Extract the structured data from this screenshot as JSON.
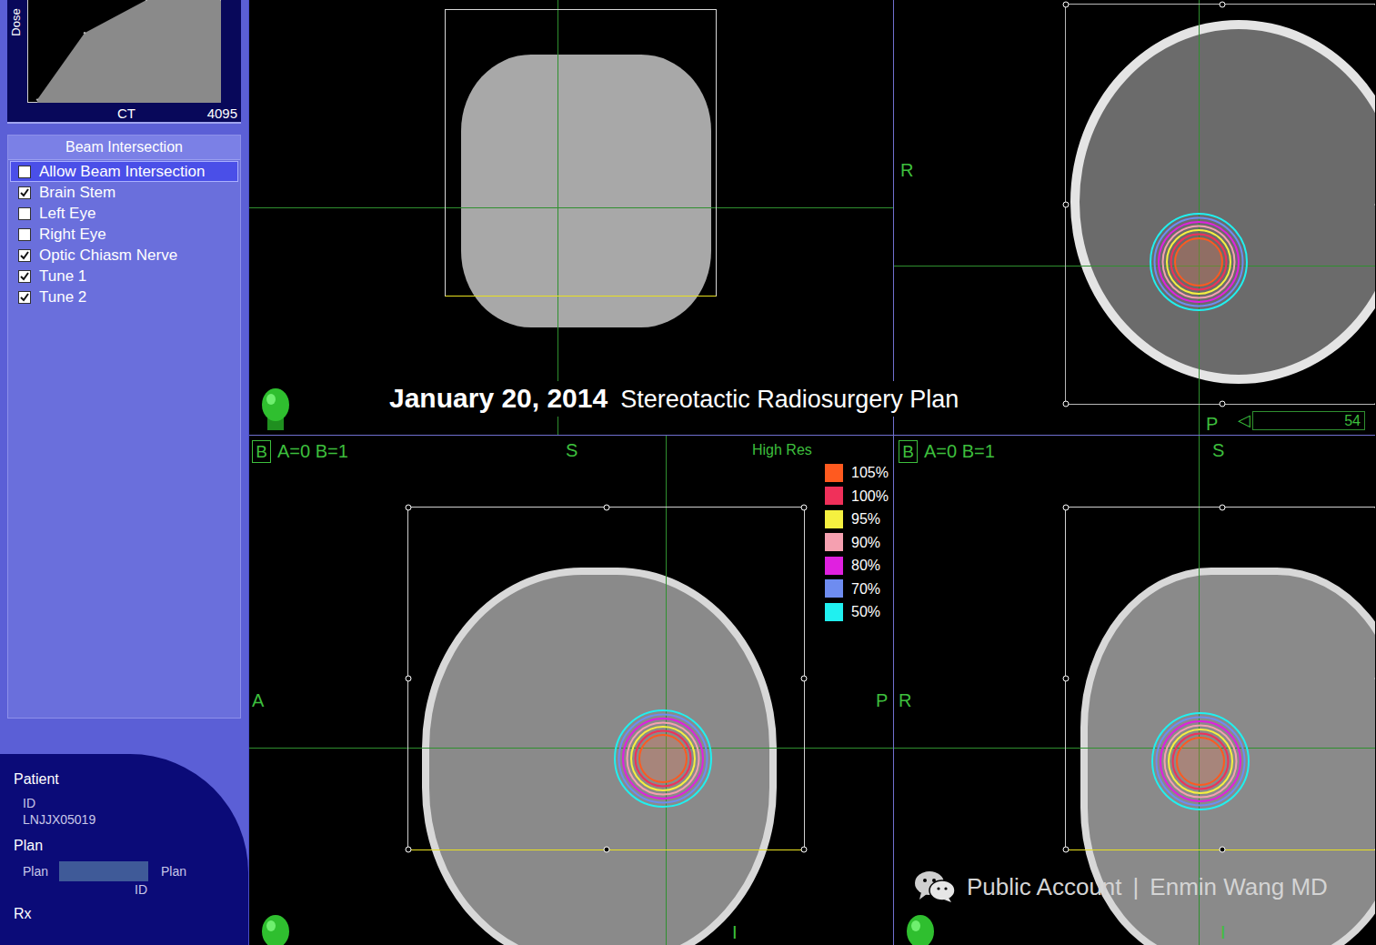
{
  "dose_chart": {
    "y_label": "Dose",
    "x_label": "CT",
    "x_max": "4095",
    "points": [
      [
        193,
        0.03
      ],
      [
        1198,
        0.68
      ],
      [
        2511,
        1.0
      ],
      [
        4095,
        1.0
      ]
    ]
  },
  "beam_intersection": {
    "title": "Beam Intersection",
    "items": [
      {
        "label": "Allow Beam Intersection",
        "checked": false,
        "selected": true
      },
      {
        "label": "Brain Stem",
        "checked": true,
        "selected": false
      },
      {
        "label": "Left Eye",
        "checked": false,
        "selected": false
      },
      {
        "label": "Right Eye",
        "checked": false,
        "selected": false
      },
      {
        "label": "Optic Chiasm Nerve",
        "checked": true,
        "selected": false
      },
      {
        "label": "Tune 1",
        "checked": true,
        "selected": false
      },
      {
        "label": "Tune 2",
        "checked": true,
        "selected": false
      }
    ]
  },
  "patient": {
    "title": "Patient",
    "id_label": "ID",
    "id": "LNJJX05019"
  },
  "plan": {
    "title": "Plan",
    "label": "Plan",
    "unit": "Plan",
    "id_label": "ID"
  },
  "rx": {
    "title": "Rx"
  },
  "caption": {
    "date": "January 20, 2014",
    "title": "Stereotactic Radiosurgery Plan"
  },
  "views": {
    "axial": {
      "labels": {
        "left": "R",
        "bottom": "P"
      },
      "slice": {
        "arrow": "◁",
        "value": "54"
      }
    },
    "sagittal": {
      "badge": "B",
      "angles": "A=0 B=1",
      "labels": {
        "top": "S",
        "left": "A",
        "right": "P",
        "bottom": "I"
      }
    },
    "coronal": {
      "badge": "B",
      "angles": "A=0 B=1",
      "labels": {
        "top": "S",
        "left": "R",
        "bottom": "I"
      }
    }
  },
  "legend": {
    "title": "High Res",
    "items": [
      {
        "label": "105%",
        "color": "#ff5a1f"
      },
      {
        "label": "100%",
        "color": "#f0305a"
      },
      {
        "label": "95%",
        "color": "#f5f040"
      },
      {
        "label": "90%",
        "color": "#f5a0b0"
      },
      {
        "label": "80%",
        "color": "#e020e0"
      },
      {
        "label": "70%",
        "color": "#6e8cf0"
      },
      {
        "label": "50%",
        "color": "#20f0f0"
      }
    ]
  },
  "watermark": {
    "text": "Public Account",
    "separator": "|",
    "author": "Enmin Wang MD"
  }
}
